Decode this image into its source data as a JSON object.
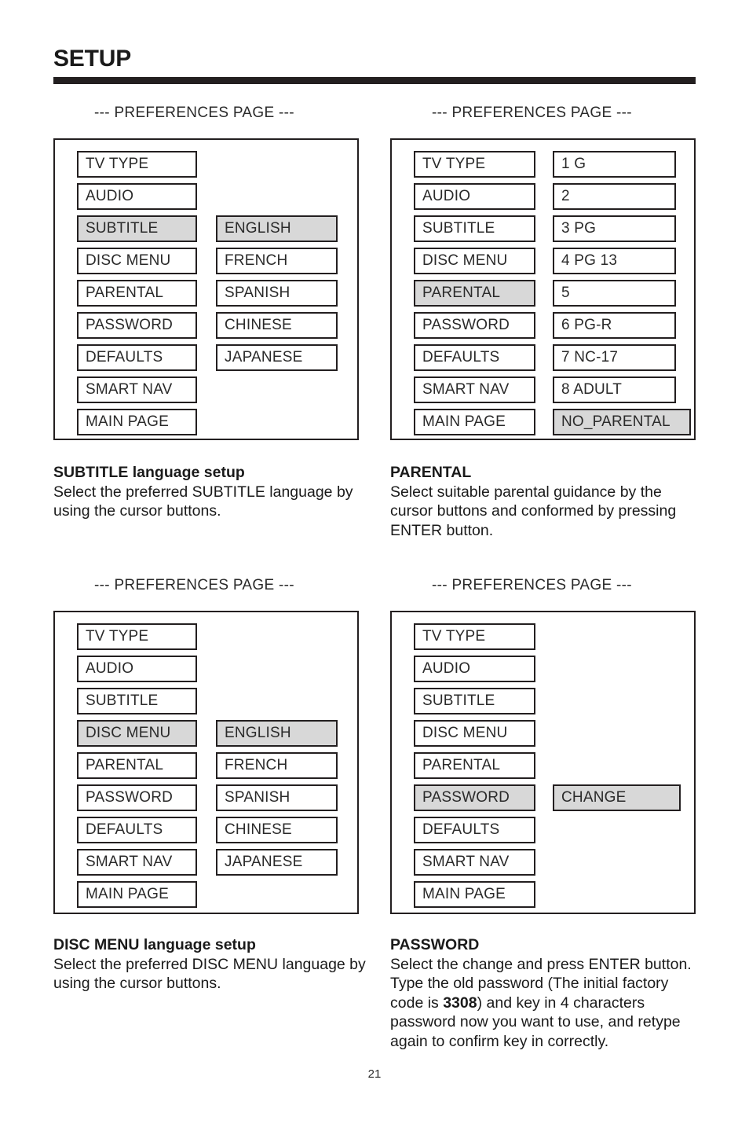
{
  "header": {
    "title": "SETUP"
  },
  "footer": {
    "page_number": "21"
  },
  "osd": {
    "caption": "--- PREFERENCES PAGE ---",
    "menu_items": [
      "TV TYPE",
      "AUDIO",
      "SUBTITLE",
      "DISC MENU",
      "PARENTAL",
      "PASSWORD",
      "DEFAULTS",
      "SMART NAV",
      "MAIN PAGE"
    ],
    "language_options": [
      "ENGLISH",
      "FRENCH",
      "SPANISH",
      "CHINESE",
      "JAPANESE"
    ],
    "parental_options": [
      "1 G",
      "2",
      "3 PG",
      "4 PG 13",
      "5",
      "6 PG-R",
      "7 NC-17",
      "8 ADULT",
      "NO_PARENTAL"
    ],
    "password_option": "CHANGE"
  },
  "panels": {
    "subtitle": {
      "caption": "--- PREFERENCES PAGE ---",
      "selected_menu": "SUBTITLE",
      "selected_value": "ENGLISH"
    },
    "parental": {
      "caption": "--- PREFERENCES PAGE ---",
      "selected_menu": "PARENTAL",
      "selected_value": "NO_PARENTAL"
    },
    "disc_menu": {
      "caption": "--- PREFERENCES PAGE ---",
      "selected_menu": "DISC MENU",
      "selected_value": "ENGLISH"
    },
    "password": {
      "caption": "--- PREFERENCES PAGE ---",
      "selected_menu": "PASSWORD",
      "selected_value": "CHANGE"
    }
  },
  "descriptions": {
    "subtitle": {
      "title": "SUBTITLE language setup",
      "body": "Select the preferred SUBTITLE language by using the cursor buttons."
    },
    "parental": {
      "title": "PARENTAL",
      "body": "Select suitable parental guidance by the cursor buttons and conformed by pressing ENTER button."
    },
    "disc_menu": {
      "title": "DISC MENU language setup",
      "body": "Select the preferred DISC MENU language by using the cursor buttons."
    },
    "password": {
      "title": "PASSWORD",
      "body_part1": "Select the change and press ENTER button.  Type the old password (The initial factory code is ",
      "body_code": "3308",
      "body_part2": ") and key in 4 characters password now you want to use, and retype again to confirm key in correctly."
    }
  },
  "colors": {
    "ink": "#231f20",
    "highlight": "#d8d8d8",
    "paper": "#ffffff"
  }
}
